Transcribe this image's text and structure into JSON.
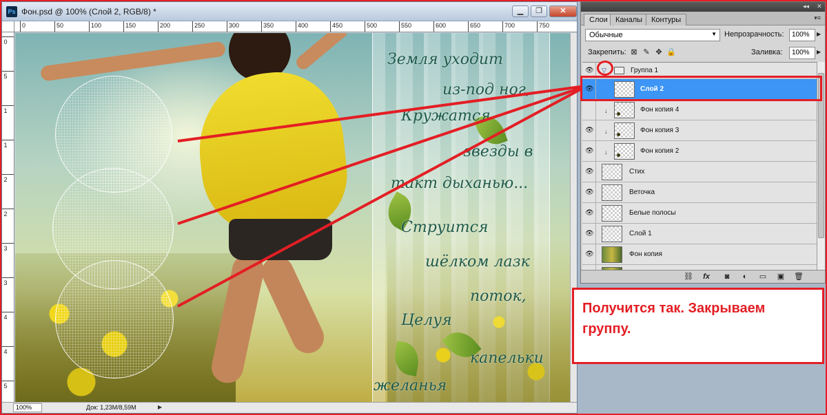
{
  "document": {
    "title": "Фон.psd @ 100% (Слой 2, RGB/8) *",
    "app_icon": "Ps",
    "window_buttons": [
      "minimize",
      "restore",
      "close"
    ],
    "ruler_top_labels": [
      "0",
      "50",
      "100",
      "150",
      "200",
      "250",
      "300",
      "350",
      "400",
      "450",
      "500",
      "550",
      "600",
      "650",
      "700",
      "750"
    ],
    "ruler_left_labels": [
      "0",
      "5",
      "1",
      "1",
      "2",
      "2",
      "3",
      "3",
      "4",
      "4",
      "5"
    ],
    "zoom": "100%",
    "doc_size": "Док: 1,23M/8,59M"
  },
  "poem": {
    "lines": [
      "Земля уходит",
      "из-под ног,",
      "Кружатся",
      "звезды в",
      "такт дыханью...",
      "Струится",
      "шёлком лазк",
      "поток,",
      "Целуя",
      "капельки",
      "желанья"
    ]
  },
  "layers_panel": {
    "tabs": [
      "Слои",
      "Каналы",
      "Контуры"
    ],
    "active_tab": 0,
    "blend_mode": "Обычные",
    "opacity_label": "Непрозрачность:",
    "opacity_value": "100%",
    "lock_label": "Закрепить:",
    "fill_label": "Заливка:",
    "fill_value": "100%",
    "group": {
      "name": "Группа 1",
      "expanded": true
    },
    "layers": [
      {
        "name": "Слой 2",
        "selected": true,
        "in_group": true,
        "thumb": "transparent"
      },
      {
        "name": "Фон копия 4",
        "selected": false,
        "in_group": true,
        "clipped": true,
        "thumb": "dot"
      },
      {
        "name": "Фон копия 3",
        "selected": false,
        "in_group": true,
        "clipped": true,
        "thumb": "dot"
      },
      {
        "name": "Фон копия 2",
        "selected": false,
        "in_group": true,
        "clipped": true,
        "thumb": "dot"
      },
      {
        "name": "Стих",
        "selected": false,
        "in_group": false,
        "thumb": "transparent"
      },
      {
        "name": "Веточка",
        "selected": false,
        "in_group": false,
        "thumb": "transparent"
      },
      {
        "name": "Белые полосы",
        "selected": false,
        "in_group": false,
        "thumb": "transparent"
      },
      {
        "name": "Слой 1",
        "selected": false,
        "in_group": false,
        "thumb": "transparent"
      },
      {
        "name": "Фон копия",
        "selected": false,
        "in_group": false,
        "thumb": "photo"
      }
    ],
    "bottom_icons": [
      "link-icon",
      "fx-icon",
      "mask-icon",
      "adjustment-icon",
      "new-group-icon",
      "new-layer-icon",
      "trash-icon"
    ]
  },
  "annotation": {
    "text": "Получится так. Закрываем группу."
  },
  "colors": {
    "annotation_red": "#e31e24",
    "selection_blue": "#3d95f5"
  }
}
